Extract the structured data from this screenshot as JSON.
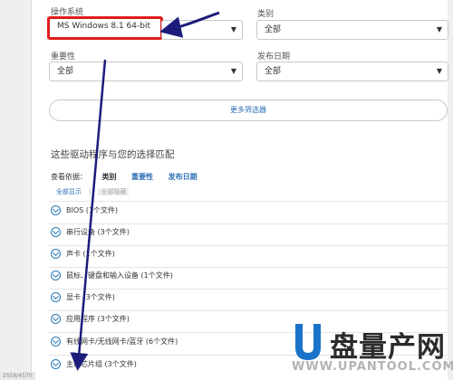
{
  "filters": {
    "os_label": "操作系统",
    "os_value": "MS Windows 8.1 64-bit",
    "category_label": "类别",
    "category_value": "全部",
    "importance_label": "重要性",
    "importance_value": "全部",
    "date_label": "发布日期",
    "date_value": "全部",
    "more_filters_button": "更多筛选器"
  },
  "results": {
    "title": "这些驱动程序与您的选择匹配",
    "sort_label": "查看依据：",
    "sort_options": [
      "类别",
      "重要性",
      "发布日期"
    ],
    "show_all": "全部显示",
    "sep": "|",
    "hide_all": "全部隐藏",
    "items": [
      {
        "label": "BIOS (1个文件)"
      },
      {
        "label": "串行设备 (3个文件)"
      },
      {
        "label": "声卡 (1个文件)"
      },
      {
        "label": "鼠标、键盘和输入设备 (1个文件)"
      },
      {
        "label": "显卡 (3个文件)"
      },
      {
        "label": "应用程序 (3个文件)"
      },
      {
        "label": "有线网卡/无线网卡/蓝牙 (6个文件)"
      },
      {
        "label": "主板芯片组 (3个文件)"
      }
    ]
  },
  "watermark": {
    "brand_cn": "盘量产网",
    "url": "WWW.UPANTOOL.COM"
  },
  "corner_label": "2558/4570",
  "colors": {
    "highlight_red": "#e01b1b",
    "arrow_navy": "#1c1c7a",
    "link_blue": "#2a6fb5"
  }
}
